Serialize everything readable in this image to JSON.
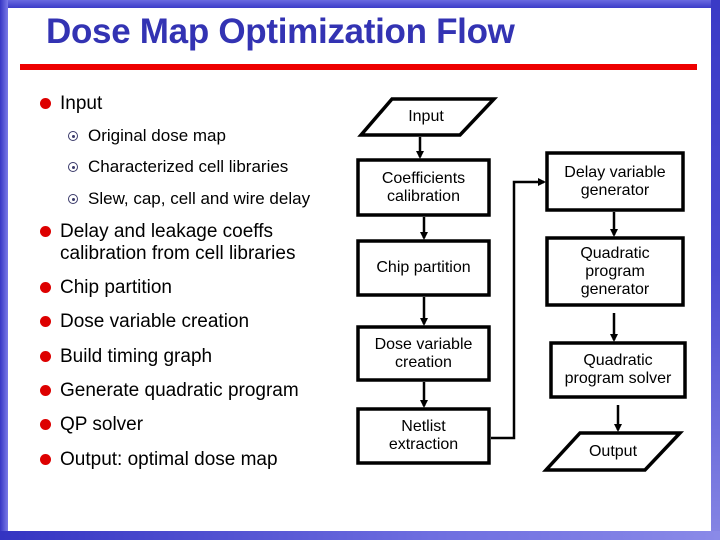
{
  "title": "Dose Map Optimization Flow",
  "colors": {
    "title": "#3333b3",
    "rule": "#ee0000",
    "bullet": "#dd0000",
    "frame": "#3c3cc8"
  },
  "bullets": [
    {
      "text": "Input",
      "subitems": [
        "Original dose map",
        "Characterized cell libraries",
        "Slew, cap, cell and wire delay"
      ]
    },
    {
      "text_lines": [
        "Delay and leakage coeffs",
        "calibration from cell libraries"
      ]
    },
    {
      "text": "Chip partition"
    },
    {
      "text": "Dose variable creation"
    },
    {
      "text": "Build timing graph"
    },
    {
      "text": "Generate quadratic program"
    },
    {
      "text": "QP solver"
    },
    {
      "text": "Output: optimal dose map"
    }
  ],
  "flowchart": {
    "left_column": [
      {
        "id": "input",
        "shape": "parallelogram",
        "label": "Input"
      },
      {
        "id": "coeff",
        "shape": "rect",
        "label": "Coefficients calibration"
      },
      {
        "id": "chip",
        "shape": "rect",
        "label": "Chip partition"
      },
      {
        "id": "dose",
        "shape": "rect",
        "label": "Dose variable creation"
      },
      {
        "id": "netlist",
        "shape": "rect",
        "label": "Netlist extraction"
      }
    ],
    "right_column": [
      {
        "id": "delay",
        "shape": "rect",
        "label": "Delay variable generator"
      },
      {
        "id": "qpgen",
        "shape": "rect",
        "label": "Quadratic program generator"
      },
      {
        "id": "qpsolve",
        "shape": "rect",
        "label": "Quadratic program solver"
      },
      {
        "id": "output",
        "shape": "parallelogram",
        "label": "Output"
      }
    ],
    "edges": [
      [
        "input",
        "coeff"
      ],
      [
        "coeff",
        "chip"
      ],
      [
        "chip",
        "dose"
      ],
      [
        "dose",
        "netlist"
      ],
      [
        "netlist",
        "delay"
      ],
      [
        "delay",
        "qpgen"
      ],
      [
        "qpgen",
        "qpsolve"
      ],
      [
        "qpsolve",
        "output"
      ]
    ]
  }
}
